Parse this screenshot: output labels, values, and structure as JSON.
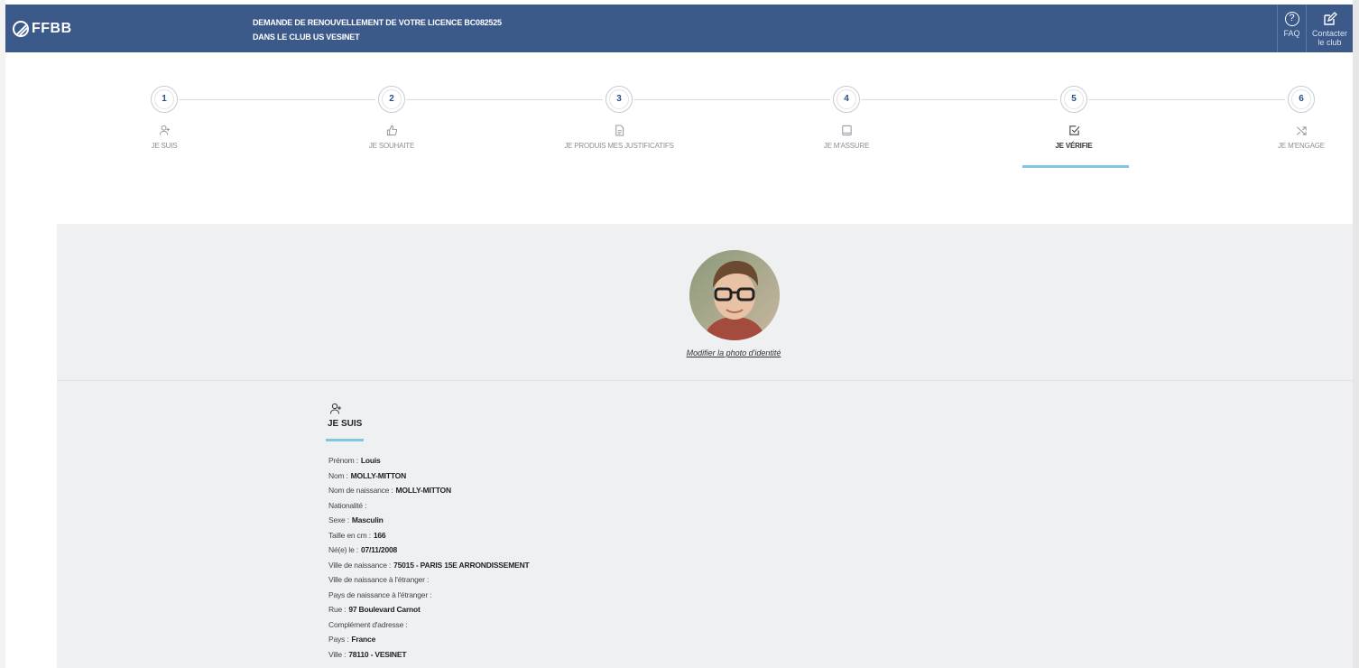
{
  "header": {
    "logo_text": "FFBB",
    "title_line1": "DEMANDE DE RENOUVELLEMENT DE VOTRE LICENCE BC082525",
    "title_line2": "DANS LE CLUB US VESINET",
    "faq_label": "FAQ",
    "contact_line1": "Contacter",
    "contact_line2": "le club"
  },
  "steps": [
    {
      "num": "1",
      "label": "JE SUIS",
      "icon": "user-plus-icon"
    },
    {
      "num": "2",
      "label": "JE SOUHAITE",
      "icon": "thumbs-up-icon"
    },
    {
      "num": "3",
      "label": "JE PRODUIS MES JUSTIFICATIFS",
      "icon": "document-icon"
    },
    {
      "num": "4",
      "label": "JE M'ASSURE",
      "icon": "book-icon"
    },
    {
      "num": "5",
      "label": "JE VÉRIFIE",
      "icon": "checkbox-icon",
      "active": true
    },
    {
      "num": "6",
      "label": "JE M'ENGAGE",
      "icon": "shuffle-icon"
    }
  ],
  "photo": {
    "modify_link": "Modifier la photo d'identité"
  },
  "section": {
    "title": "JE SUIS",
    "fields": [
      {
        "label": "Prénom :",
        "value": "Louis"
      },
      {
        "label": "Nom :",
        "value": "MOLLY-MITTON"
      },
      {
        "label": "Nom de naissance :",
        "value": "MOLLY-MITTON"
      },
      {
        "label": "Nationalité :",
        "value": ""
      },
      {
        "label": "Sexe :",
        "value": "Masculin"
      },
      {
        "label": "Taille en cm :",
        "value": "166"
      },
      {
        "label": "Né(e) le :",
        "value": "07/11/2008"
      },
      {
        "label": "Ville de naissance :",
        "value": "75015 - PARIS 15E ARRONDISSEMENT"
      },
      {
        "label": "Ville de naissance à l'étranger :",
        "value": ""
      },
      {
        "label": "Pays de naissance à l'étranger :",
        "value": ""
      },
      {
        "label": "Rue :",
        "value": "97 Boulevard Carnot"
      },
      {
        "label": "Complément d'adresse :",
        "value": ""
      },
      {
        "label": "Pays :",
        "value": "France"
      },
      {
        "label": "Ville :",
        "value": "78110 - VESINET"
      }
    ]
  },
  "colors": {
    "header_bg": "#3b5a8a",
    "accent": "#7dc7e3",
    "panel_bg": "#eff0f2"
  }
}
